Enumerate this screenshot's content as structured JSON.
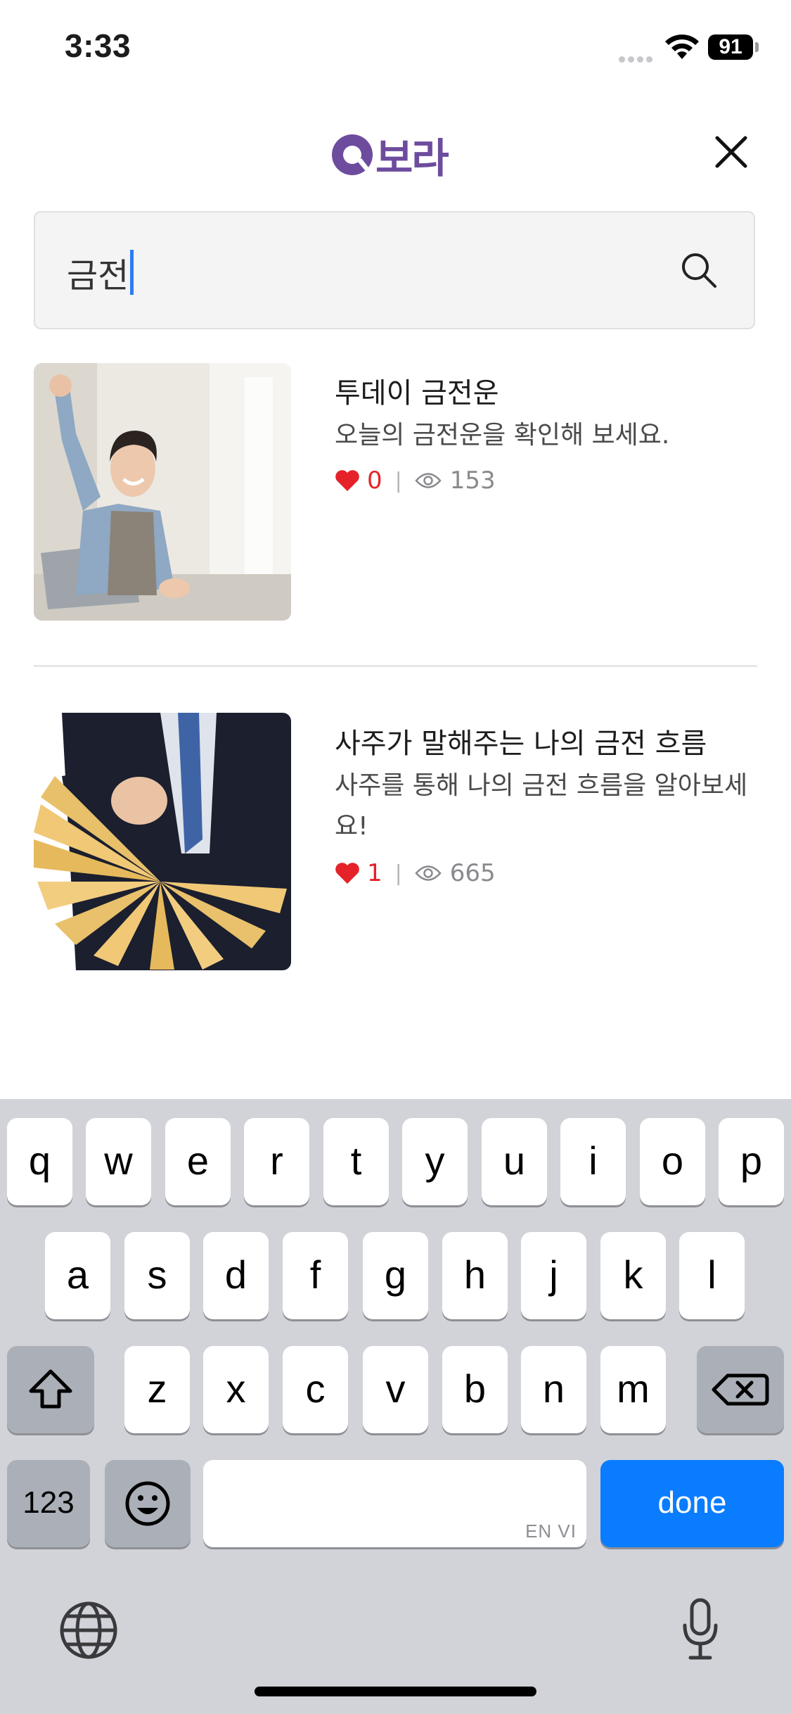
{
  "status_bar": {
    "time": "3:33",
    "battery": "91"
  },
  "header": {
    "logo_text": "보라"
  },
  "search": {
    "value": "금전"
  },
  "results": [
    {
      "title": "투데이 금전운",
      "description": "오늘의 금전운을 확인해 보세요.",
      "likes": "0",
      "views": "153"
    },
    {
      "title": "사주가 말해주는 나의 금전 흐름",
      "description": "사주를 통해 나의 금전 흐름을 알아보세요!",
      "likes": "1",
      "views": "665"
    }
  ],
  "keyboard": {
    "row1": [
      "q",
      "w",
      "e",
      "r",
      "t",
      "y",
      "u",
      "i",
      "o",
      "p"
    ],
    "row2": [
      "a",
      "s",
      "d",
      "f",
      "g",
      "h",
      "j",
      "k",
      "l"
    ],
    "row3": [
      "z",
      "x",
      "c",
      "v",
      "b",
      "n",
      "m"
    ],
    "numbers_label": "123",
    "space_hint": "EN VI",
    "done_label": "done"
  },
  "colors": {
    "brand": "#6d4c9e",
    "like": "#e52229",
    "done_key": "#0a7cff",
    "caret": "#2d7cf6"
  }
}
